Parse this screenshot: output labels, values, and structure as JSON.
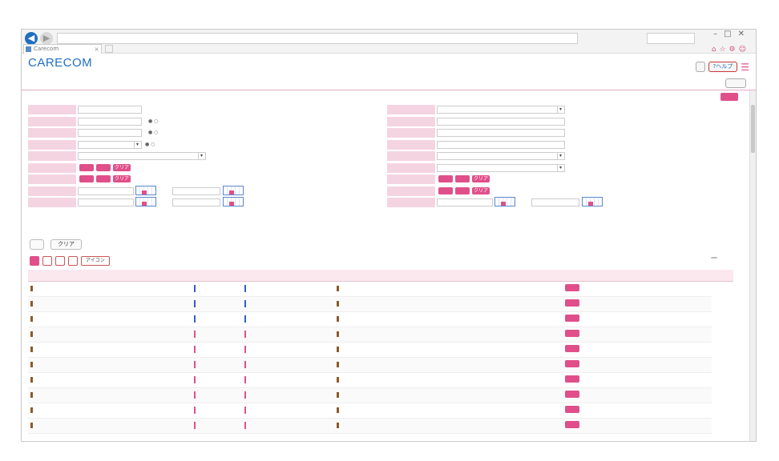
{
  "app": {
    "logo": "CARECOM",
    "tab_title": "Carecom"
  },
  "header": {
    "user_button": "",
    "help_button": "?ヘルプ",
    "breadcrumb": "",
    "all_button": ""
  },
  "section": {
    "title": "",
    "toggle_button": ""
  },
  "form": {
    "left_labels": [
      "",
      "",
      "",
      "",
      "",
      "",
      "",
      "",
      ""
    ],
    "right_labels": [
      "",
      "",
      "",
      "",
      "",
      "",
      "",
      "",
      ""
    ],
    "buttons": {
      "select_all": "",
      "select": "",
      "clear": "クリア"
    },
    "search_button": "",
    "clear_button": "クリア"
  },
  "view_tabs": [
    "",
    "",
    "",
    "",
    "アイコン"
  ],
  "result_count": "",
  "pager": {
    "page_prev": "",
    "page_current": "",
    "next": ""
  },
  "table": {
    "headers": [
      "",
      "",
      "",
      "",
      "",
      "",
      "",
      "",
      "",
      "",
      "",
      "",
      "",
      "",
      "",
      "",
      "",
      "",
      "",
      "",
      ""
    ],
    "rows": [
      {
        "room": "",
        "bed": "",
        "id": "",
        "family": "",
        "given": "",
        "status": "",
        "sex": "",
        "sex2": "",
        "birth": "",
        "age": "",
        "dept": "",
        "admit": "",
        "days": "",
        "sexcolor": "#2f5fc0",
        "hl": false
      },
      {
        "room": "",
        "bed": "",
        "id": "",
        "family": "",
        "given": "",
        "status": "",
        "sex": "",
        "sex2": "",
        "birth": "",
        "age": "",
        "dept": "",
        "admit": "",
        "days": "",
        "sexcolor": "#2f5fc0",
        "hl": false
      },
      {
        "room": "",
        "bed": "",
        "id": "",
        "family": "",
        "given": "",
        "status": "",
        "sex": "",
        "sex2": "",
        "birth": "",
        "age": "",
        "dept": "",
        "admit": "",
        "days": "",
        "sexcolor": "#2f5fc0",
        "hl": false
      },
      {
        "room": "",
        "bed": "",
        "id": "",
        "family": "",
        "given": "",
        "status": "",
        "sex": "",
        "sex2": "",
        "birth": "",
        "age": "",
        "dept": "",
        "admit": "",
        "days": "",
        "sexcolor": "#e04f8a",
        "hl": true
      },
      {
        "room": "",
        "bed": "",
        "id": "",
        "family": "",
        "given": "",
        "status": "",
        "sex": "",
        "sex2": "",
        "birth": "",
        "age": "",
        "dept": "",
        "admit": "",
        "days": "",
        "sexcolor": "#e04f8a",
        "hl": true
      },
      {
        "room": "",
        "bed": "",
        "id": "",
        "family": "",
        "given": "",
        "status": "",
        "sex": "",
        "sex2": "",
        "birth": "",
        "age": "",
        "dept": "",
        "admit": "",
        "days": "",
        "sexcolor": "#e04f8a",
        "hl": true
      },
      {
        "room": "",
        "bed": "",
        "id": "",
        "family": "",
        "given": "",
        "status": "",
        "sex": "",
        "sex2": "",
        "birth": "",
        "age": "",
        "dept": "",
        "admit": "",
        "days": "",
        "sexcolor": "#e04f8a",
        "hl": false
      },
      {
        "room": "",
        "bed": "",
        "id": "",
        "family": "",
        "given": "",
        "status": "",
        "sex": "",
        "sex2": "",
        "birth": "",
        "age": "",
        "dept": "",
        "admit": "",
        "days": "",
        "sexcolor": "#e04f8a",
        "hl": false
      },
      {
        "room": "",
        "bed": "",
        "id": "",
        "family": "",
        "given": "",
        "status": "",
        "sex": "",
        "sex2": "",
        "birth": "",
        "age": "",
        "dept": "",
        "admit": "",
        "days": "",
        "sexcolor": "#e04f8a",
        "hl": false
      },
      {
        "room": "",
        "bed": "",
        "id": "",
        "family": "",
        "given": "",
        "status": "",
        "sex": "",
        "sex2": "",
        "birth": "",
        "age": "",
        "dept": "",
        "admit": "",
        "days": "",
        "sexcolor": "#e04f8a",
        "hl": false
      }
    ]
  },
  "colors": {
    "accent": "#e04f8a",
    "brand": "#1f6fc0",
    "label_bg": "#f5d4e1"
  },
  "footer": {
    "copyright": ""
  }
}
